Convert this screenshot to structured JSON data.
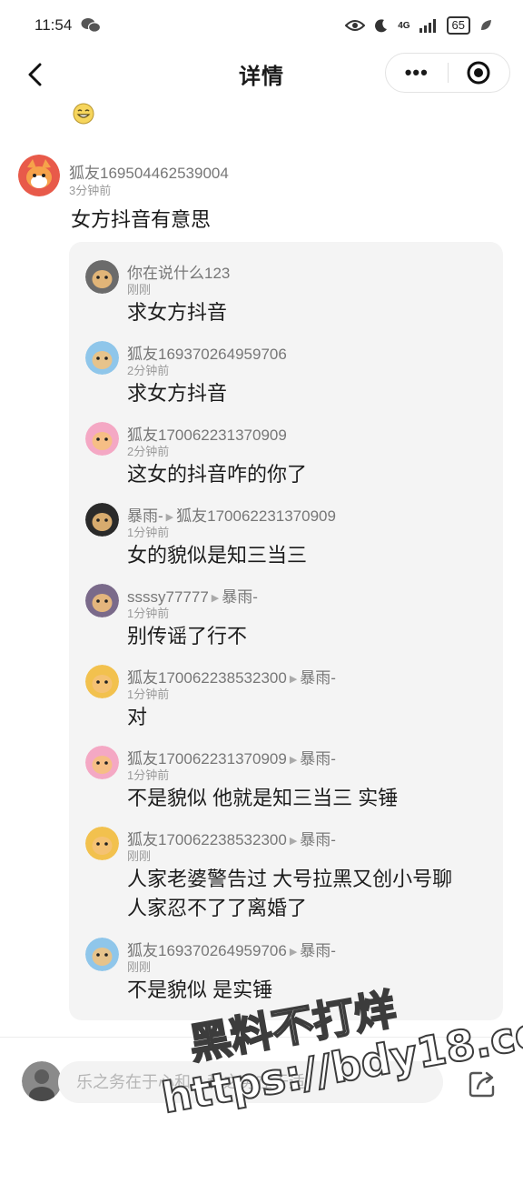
{
  "status_bar": {
    "time": "11:54",
    "network": "4G",
    "battery": "65"
  },
  "nav": {
    "title": "详情",
    "more_label": "•••"
  },
  "main_comment": {
    "user": "狐友169504462539004",
    "time": "3分钟前",
    "text": "女方抖音有意思"
  },
  "replies": [
    {
      "user": "你在说什么123",
      "reply_to": "",
      "time": "刚刚",
      "text": "求女方抖音",
      "avatar_color": "#6b6b6b"
    },
    {
      "user": "狐友169370264959706",
      "reply_to": "",
      "time": "2分钟前",
      "text": "求女方抖音",
      "avatar_color": "#8fc6ea"
    },
    {
      "user": "狐友170062231370909",
      "reply_to": "",
      "time": "2分钟前",
      "text": "这女的抖音咋的你了",
      "avatar_color": "#f4a8c4"
    },
    {
      "user": "暴雨-",
      "reply_to": "狐友170062231370909",
      "time": "1分钟前",
      "text": "女的貌似是知三当三",
      "avatar_color": "#2a2a2a"
    },
    {
      "user": "ssssy77777",
      "reply_to": "暴雨-",
      "time": "1分钟前",
      "text": "别传谣了行不",
      "avatar_color": "#7a6a8a"
    },
    {
      "user": "狐友170062238532300",
      "reply_to": "暴雨-",
      "time": "1分钟前",
      "text": "对",
      "avatar_color": "#f2c14e"
    },
    {
      "user": "狐友170062231370909",
      "reply_to": "暴雨-",
      "time": "1分钟前",
      "text": "不是貌似 他就是知三当三 实锤",
      "avatar_color": "#f4a8c4"
    },
    {
      "user": "狐友170062238532300",
      "reply_to": "暴雨-",
      "time": "刚刚",
      "text": "人家老婆警告过 大号拉黑又创小号聊\n人家忍不了了离婚了",
      "avatar_color": "#f2c14e"
    },
    {
      "user": "狐友169370264959706",
      "reply_to": "暴雨-",
      "time": "刚刚",
      "text": "不是貌似 是实锤",
      "avatar_color": "#8fc6ea"
    }
  ],
  "input": {
    "placeholder": "乐之务在于心和，和之务在于适。"
  },
  "watermark": {
    "line1": "黑料不打烊",
    "line2": "https://bdy18.co"
  },
  "icons": {
    "back": "chevron-left-icon",
    "more": "more-dots-icon",
    "target": "target-icon",
    "share": "share-icon",
    "emoji": "grin-emoji-icon"
  }
}
